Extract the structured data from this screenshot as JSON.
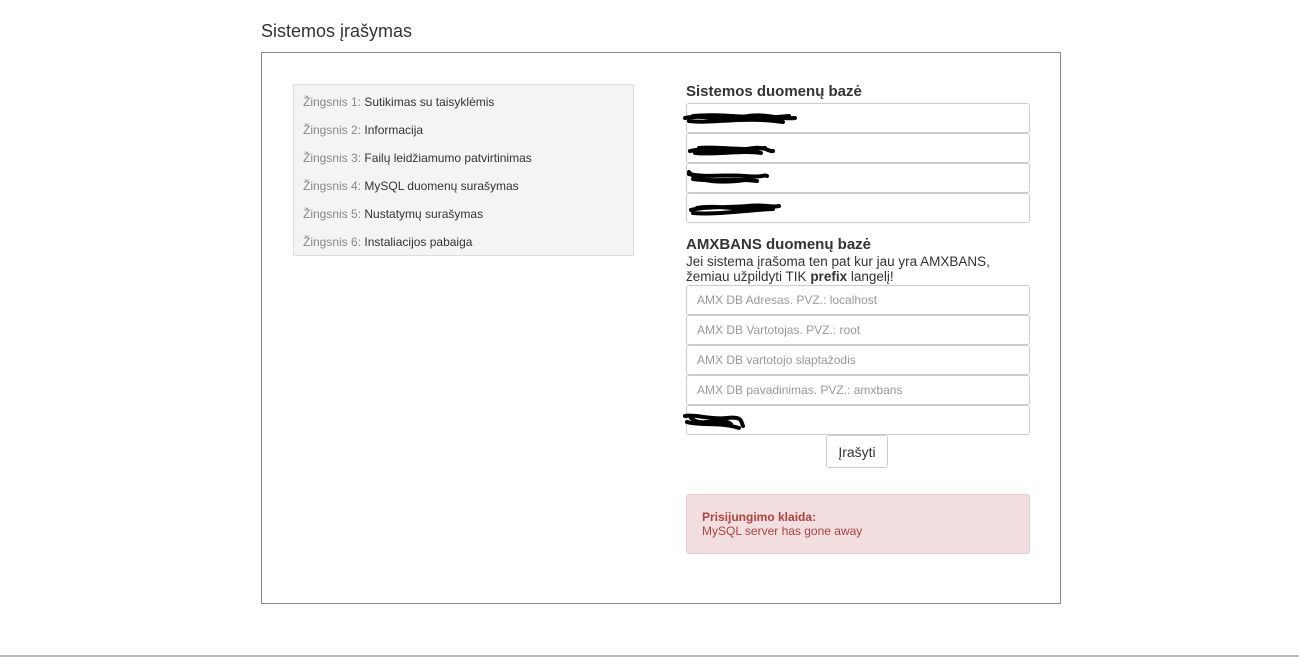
{
  "page": {
    "title": "Sistemos įrašymas"
  },
  "steps": [
    {
      "prefix": "Žingsnis 1:",
      "label": "Sutikimas su taisyklėmis"
    },
    {
      "prefix": "Žingsnis 2:",
      "label": "Informacija"
    },
    {
      "prefix": "Žingsnis 3:",
      "label": "Failų leidžiamumo patvirtinimas"
    },
    {
      "prefix": "Žingsnis 4:",
      "label": "MySQL duomenų surašymas"
    },
    {
      "prefix": "Žingsnis 5:",
      "label": "Nustatymų surašymas"
    },
    {
      "prefix": "Žingsnis 6:",
      "label": "Instaliacijos pabaiga"
    }
  ],
  "system_db": {
    "title": "Sistemos duomenų bazė"
  },
  "amx_db": {
    "title": "AMXBANS duomenų bazė",
    "note_part1": "Jei sistema įrašoma ten pat kur jau yra AMXBANS, žemiau užpildyti TIK ",
    "note_bold": "prefix",
    "note_part2": " langelį!",
    "host_placeholder": "AMX DB Adresas. PVZ.: localhost",
    "user_placeholder": "AMX DB Vartotojas. PVZ.: root",
    "password_placeholder": "AMX DB vartotojo slaptažodis",
    "name_placeholder": "AMX DB pavadinimas. PVZ.: amxbans"
  },
  "submit_label": "Įrašyti",
  "alert": {
    "title": "Prisijungimo klaida:",
    "message": "MySQL server has gone away"
  },
  "colors": {
    "alert_bg": "#f2dede",
    "alert_text": "#a94442",
    "redaction": "#000000"
  }
}
